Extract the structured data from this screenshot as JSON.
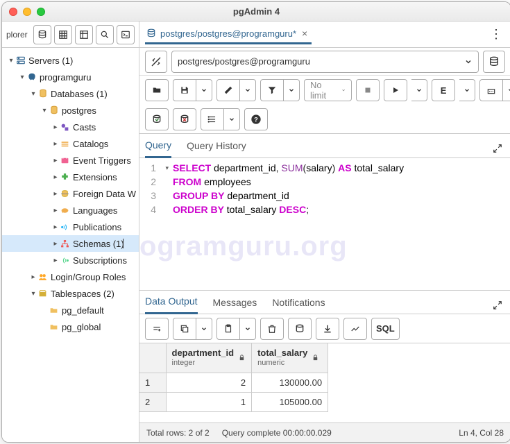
{
  "window": {
    "title": "pgAdmin 4"
  },
  "sidebar": {
    "label": "plorer"
  },
  "tree": {
    "servers": "Servers (1)",
    "programguru": "programguru",
    "databases": "Databases (1)",
    "postgres": "postgres",
    "casts": "Casts",
    "catalogs": "Catalogs",
    "event_triggers": "Event Triggers",
    "extensions": "Extensions",
    "fdw": "Foreign Data W",
    "languages": "Languages",
    "publications": "Publications",
    "schemas": "Schemas (1)",
    "subscriptions": "Subscriptions",
    "login_roles": "Login/Group Roles",
    "tablespaces": "Tablespaces (2)",
    "pg_default": "pg_default",
    "pg_global": "pg_global"
  },
  "tab": {
    "label": "postgres/postgres@programguru*"
  },
  "conn": {
    "value": "postgres/postgres@programguru"
  },
  "toolbar": {
    "nolimit": "No limit"
  },
  "query_tabs": {
    "query": "Query",
    "history": "Query History"
  },
  "sql": {
    "l1_select": "SELECT",
    "l1_id": " department_id",
    "l1_comma": ", ",
    "l1_sum": "SUM",
    "l1_paren1": "(",
    "l1_sal": "salary",
    "l1_paren2": ") ",
    "l1_as": "AS",
    "l1_ts": " total_salary",
    "l2_from": "FROM",
    "l2_emp": " employees",
    "l3_group": "GROUP",
    "l3_by": " BY",
    "l3_dep": " department_id",
    "l4_order": "ORDER",
    "l4_by": " BY",
    "l4_ts": " total_salary ",
    "l4_desc": "DESC",
    "l4_semi": ";"
  },
  "watermark": "ogramguru.org",
  "output_tabs": {
    "data": "Data Output",
    "messages": "Messages",
    "notifications": "Notifications"
  },
  "out_toolbar": {
    "sql": "SQL"
  },
  "chart_data": {
    "type": "table",
    "columns": [
      {
        "name": "department_id",
        "type": "integer"
      },
      {
        "name": "total_salary",
        "type": "numeric"
      }
    ],
    "rows": [
      {
        "n": "1",
        "department_id": "2",
        "total_salary": "130000.00"
      },
      {
        "n": "2",
        "department_id": "1",
        "total_salary": "105000.00"
      }
    ]
  },
  "status": {
    "rows": "Total rows: 2 of 2",
    "time": "Query complete 00:00:00.029",
    "pos": "Ln 4, Col 28"
  }
}
